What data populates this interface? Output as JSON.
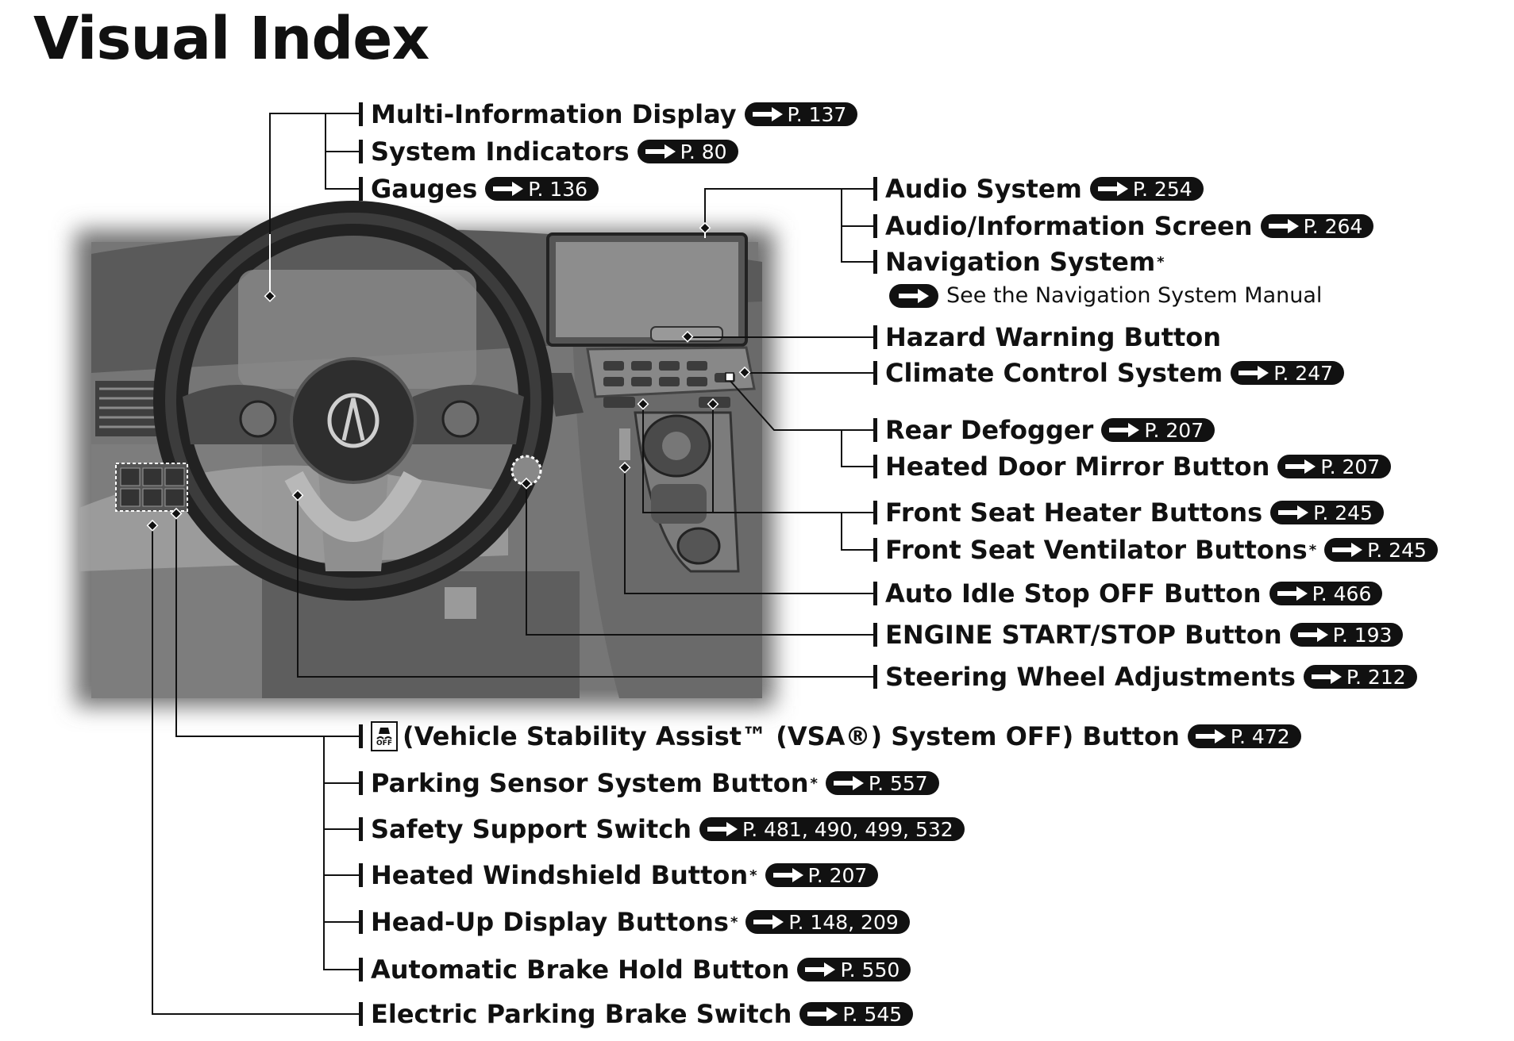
{
  "page": {
    "title": "Visual Index"
  },
  "labels": {
    "mid": {
      "text": "Multi-Information Display",
      "ref": "P. 137"
    },
    "sys_ind": {
      "text": "System Indicators",
      "ref": "P. 80"
    },
    "gauges": {
      "text": "Gauges",
      "ref": "P. 136"
    },
    "audio": {
      "text": "Audio System",
      "ref": "P. 254"
    },
    "audio_info": {
      "text": "Audio/Information Screen",
      "ref": "P. 264"
    },
    "nav": {
      "text": "Navigation System",
      "asterisk": "*",
      "note": "See the Navigation System Manual"
    },
    "hazard": {
      "text": "Hazard Warning Button"
    },
    "climate": {
      "text": "Climate Control System",
      "ref": "P. 247"
    },
    "rear_defog": {
      "text": "Rear Defogger",
      "ref": "P. 207"
    },
    "mirror": {
      "text": "Heated Door Mirror Button",
      "ref": "P. 207"
    },
    "seat_heater": {
      "text": "Front Seat Heater Buttons",
      "ref": "P. 245"
    },
    "seat_vent": {
      "text": "Front Seat Ventilator Buttons",
      "asterisk": "*",
      "ref": "P. 245"
    },
    "idle_stop": {
      "text": "Auto Idle Stop OFF Button",
      "ref": "P. 466"
    },
    "engine": {
      "text": "ENGINE START/STOP Button",
      "ref": "P. 193"
    },
    "steering": {
      "text": "Steering Wheel Adjustments",
      "ref": "P. 212"
    },
    "vsa": {
      "text": "(Vehicle Stability Assist™ (VSA®) System OFF) Button",
      "icon_text": "OFF",
      "ref": "P. 472"
    },
    "parking": {
      "text": "Parking Sensor System Button",
      "asterisk": "*",
      "ref": "P. 557"
    },
    "safety": {
      "text": "Safety Support Switch",
      "ref": "P. 481, 490, 499, 532"
    },
    "windshield": {
      "text": "Heated Windshield Button",
      "asterisk": "*",
      "ref": "P. 207"
    },
    "hud": {
      "text": "Head-Up Display Buttons",
      "asterisk": "*",
      "ref": "P. 148, 209"
    },
    "brake_hold": {
      "text": "Automatic Brake Hold Button",
      "ref": "P. 550"
    },
    "epb": {
      "text": "Electric Parking Brake Switch",
      "ref": "P. 545"
    }
  },
  "colors": {
    "ink": "#111111",
    "photo_bg": "#6e6e6e",
    "photo_dark": "#3a3a3a",
    "photo_light": "#bdbdbd"
  },
  "icons": [
    "arrow-right-icon",
    "vsa-off-icon",
    "acura-logo-icon"
  ]
}
